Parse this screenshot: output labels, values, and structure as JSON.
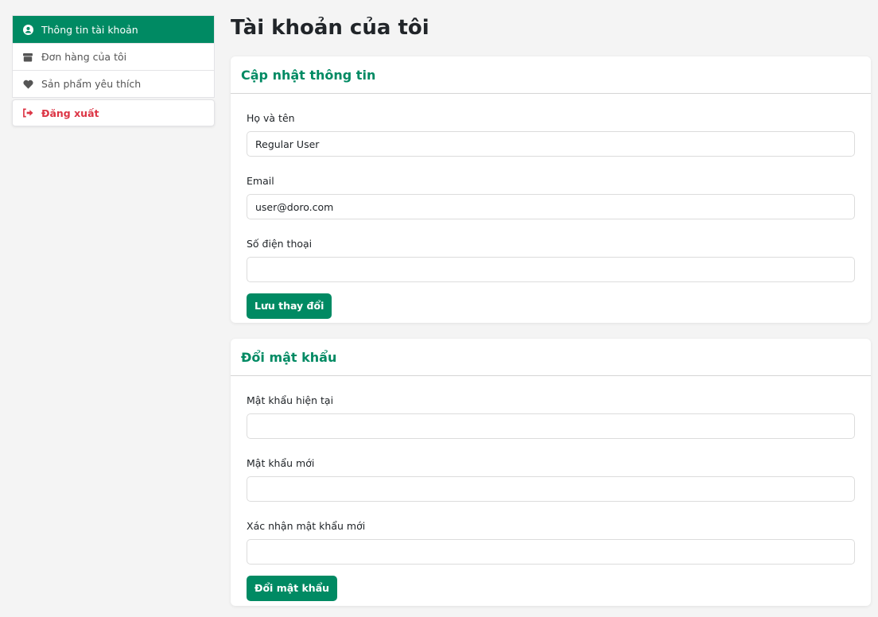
{
  "sidebar": {
    "items": [
      {
        "label": "Thông tin tài khoản",
        "icon": "user-circle-icon",
        "active": true
      },
      {
        "label": "Đơn hàng của tôi",
        "icon": "box-icon"
      },
      {
        "label": "Sản phẩm yêu thích",
        "icon": "heart-icon"
      }
    ],
    "logout": {
      "label": "Đăng xuất",
      "icon": "sign-out-icon"
    }
  },
  "page_title": "Tài khoản của tôi",
  "profile": {
    "title": "Cập nhật thông tin",
    "name_label": "Họ và tên",
    "name_value": "Regular User",
    "email_label": "Email",
    "email_value": "user@doro.com",
    "phone_label": "Số điện thoại",
    "phone_value": "",
    "save_label": "Lưu thay đổi"
  },
  "password": {
    "title": "Đổi mật khẩu",
    "current_label": "Mật khẩu hiện tại",
    "new_label": "Mật khẩu mới",
    "confirm_label": "Xác nhận mật khẩu mới",
    "submit_label": "Đổi mật khẩu"
  },
  "colors": {
    "accent": "#008a63",
    "danger": "#dc3545"
  }
}
